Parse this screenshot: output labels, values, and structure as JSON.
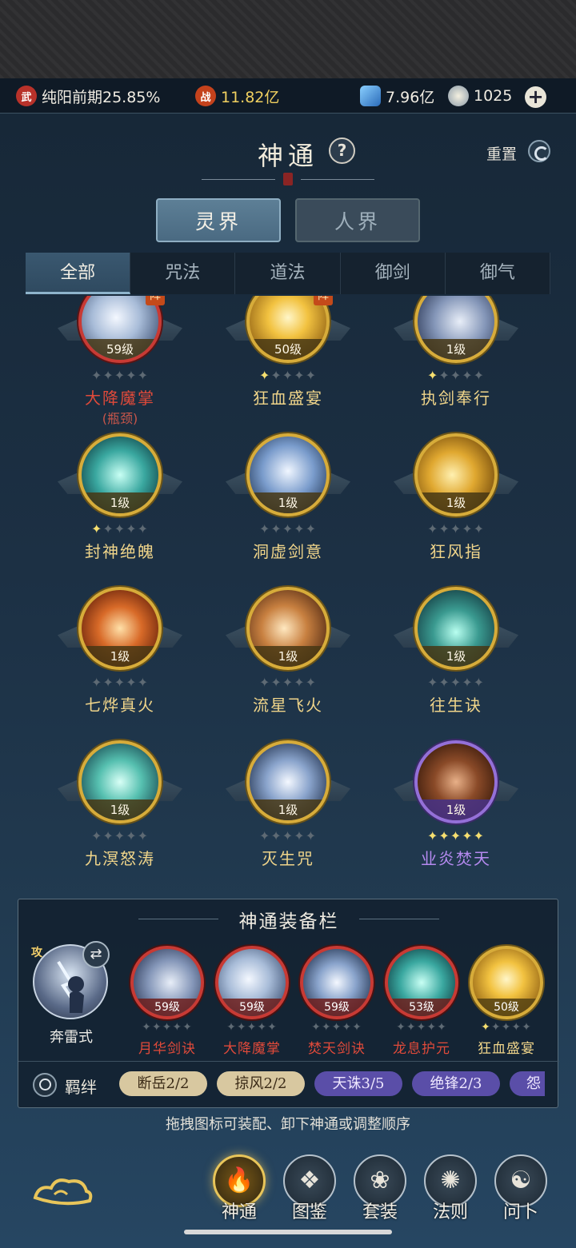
{
  "resources": {
    "realm": "纯阳前期25.85%",
    "realm_icon": "武",
    "power": "11.82亿",
    "power_icon": "战",
    "spirit_stones": "7.96亿",
    "jade": "1025"
  },
  "header": {
    "title": "神通",
    "help": "?",
    "reset": "重置"
  },
  "realm_tabs": [
    "灵界",
    "人界"
  ],
  "category_tabs": [
    "全部",
    "咒法",
    "道法",
    "御剑",
    "御气"
  ],
  "skills": [
    {
      "level": "59级",
      "name": "大降魔掌",
      "sub": "(瓶颈)",
      "stars": 0,
      "frame": "red",
      "badge": "阵",
      "art": "palm"
    },
    {
      "level": "50级",
      "name": "狂血盛宴",
      "stars": 1,
      "frame": "gold",
      "badge": "阵",
      "art": "gold-burst"
    },
    {
      "level": "1级",
      "name": "执剑奉行",
      "stars": 1,
      "frame": "gold",
      "art": "silver-swirl"
    },
    {
      "level": "1级",
      "name": "封神绝魄",
      "stars": 1,
      "frame": "gold",
      "art": "teal-vortex"
    },
    {
      "level": "1级",
      "name": "洞虚剑意",
      "stars": 0,
      "frame": "gold",
      "art": "blue-sword"
    },
    {
      "level": "1级",
      "name": "狂风指",
      "stars": 0,
      "frame": "gold",
      "art": "gold-fist"
    },
    {
      "level": "1级",
      "name": "七烨真火",
      "stars": 0,
      "frame": "gold",
      "art": "fire-swirl"
    },
    {
      "level": "1级",
      "name": "流星飞火",
      "stars": 0,
      "frame": "gold",
      "art": "fire-fist"
    },
    {
      "level": "1级",
      "name": "往生诀",
      "stars": 0,
      "frame": "gold",
      "art": "teal-flames"
    },
    {
      "level": "1级",
      "name": "九溟怒涛",
      "stars": 0,
      "frame": "gold",
      "art": "teal-tornado"
    },
    {
      "level": "1级",
      "name": "灭生咒",
      "stars": 0,
      "frame": "gold",
      "art": "blue-arc"
    },
    {
      "level": "1级",
      "name": "业炎焚天",
      "stars": 5,
      "frame": "purple",
      "art": "brown-rock"
    }
  ],
  "equip_bar": {
    "title": "神通装备栏",
    "hero_name": "奔雷式",
    "hero_tag": "攻",
    "slots": [
      {
        "level": "59级",
        "name": "月华剑诀",
        "stars": 0,
        "frame": "red",
        "art": "silver-swirl"
      },
      {
        "level": "59级",
        "name": "大降魔掌",
        "stars": 0,
        "frame": "red",
        "art": "palm"
      },
      {
        "level": "59级",
        "name": "焚天剑诀",
        "stars": 0,
        "frame": "red",
        "art": "blue-arc"
      },
      {
        "level": "53级",
        "name": "龙息护元",
        "stars": 0,
        "frame": "red",
        "art": "teal-vortex"
      },
      {
        "level": "50级",
        "name": "狂血盛宴",
        "stars": 1,
        "frame": "gold",
        "art": "gold-burst"
      }
    ],
    "bond_label": "羁绊",
    "bonds": [
      {
        "text": "断岳2/2",
        "style": "tan"
      },
      {
        "text": "掠风2/2",
        "style": "tan"
      },
      {
        "text": "天诛3/5",
        "style": "purple"
      },
      {
        "text": "绝锋2/3",
        "style": "purple"
      },
      {
        "text": "怨",
        "style": "purple"
      }
    ]
  },
  "hint": "拖拽图标可装配、卸下神通或调整顺序",
  "bottom_nav": [
    "神通",
    "图鉴",
    "套装",
    "法则",
    "问卜"
  ],
  "colors": {
    "gold_frame": "#d7ac3a",
    "red_frame": "#c83a34",
    "purple_frame": "#9470d8",
    "background": "#1e3347"
  }
}
